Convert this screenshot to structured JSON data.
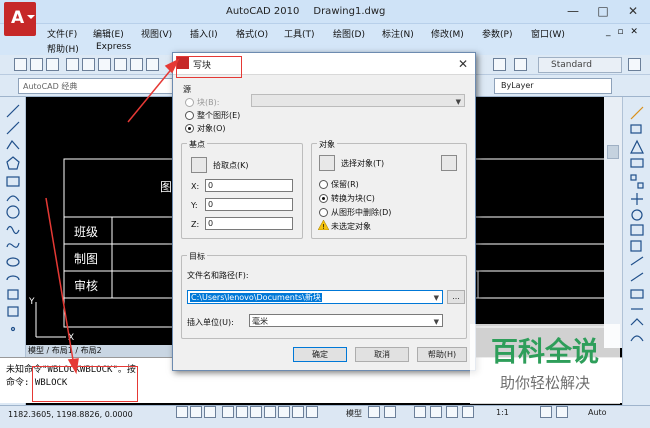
{
  "app": {
    "title": "AutoCAD 2010",
    "document": "Drawing1.dwg"
  },
  "window_controls": {
    "minimize": "—",
    "maximize": "□",
    "close": "✕"
  },
  "menu": [
    "文件(F)",
    "编辑(E)",
    "视图(V)",
    "插入(I)",
    "格式(O)",
    "工具(T)",
    "绘图(D)",
    "标注(N)",
    "修改(M)",
    "参数(P)",
    "窗口(W)",
    "帮助(H)",
    "Express"
  ],
  "doc_controls": "_ ▫ ✕",
  "workspace": "AutoCAD 经典",
  "text_style": "Standard",
  "layer": "ByLayer",
  "drawing": {
    "partial_label": "图",
    "rows": [
      "班级",
      "制图",
      "审核"
    ]
  },
  "layout_tabs": "模型 / 布局1 / 布局2",
  "command_lines": [
    "未知命令\"WBLOCKWBLOCK\"。按",
    "命令: WBLOCK"
  ],
  "coordinates": "1182.3605, 1198.8826, 0.0000",
  "status": {
    "model": "模型",
    "scale": "1:1",
    "auto": "Auto"
  },
  "dialog": {
    "title": "写块",
    "close": "✕",
    "source": {
      "label": "源",
      "options": [
        "块(B):",
        "整个图形(E)",
        "对象(O)"
      ],
      "selected": "对象(O)"
    },
    "base_point": {
      "label": "基点",
      "pick": "拾取点(K)",
      "x_label": "X:",
      "y_label": "Y:",
      "z_label": "Z:",
      "x": "0",
      "y": "0",
      "z": "0"
    },
    "objects": {
      "label": "对象",
      "select": "选择对象(T)",
      "options": [
        "保留(R)",
        "转换为块(C)",
        "从图形中删除(D)"
      ],
      "selected": "转换为块(C)",
      "warning": "未选定对象"
    },
    "target": {
      "label": "目标",
      "file_label": "文件名和路径(F):",
      "path": "C:\\Users\\lenovo\\Documents\\新块",
      "browse": "...",
      "units_label": "插入单位(U):",
      "units": "毫米"
    },
    "buttons": {
      "ok": "确定",
      "cancel": "取消",
      "help": "帮助(H)"
    }
  },
  "watermark": {
    "main": "百科全说",
    "sub": "助你轻松解决"
  },
  "colors": {
    "accent_red": "#e53935",
    "watermark_green": "#2e9e5a"
  }
}
